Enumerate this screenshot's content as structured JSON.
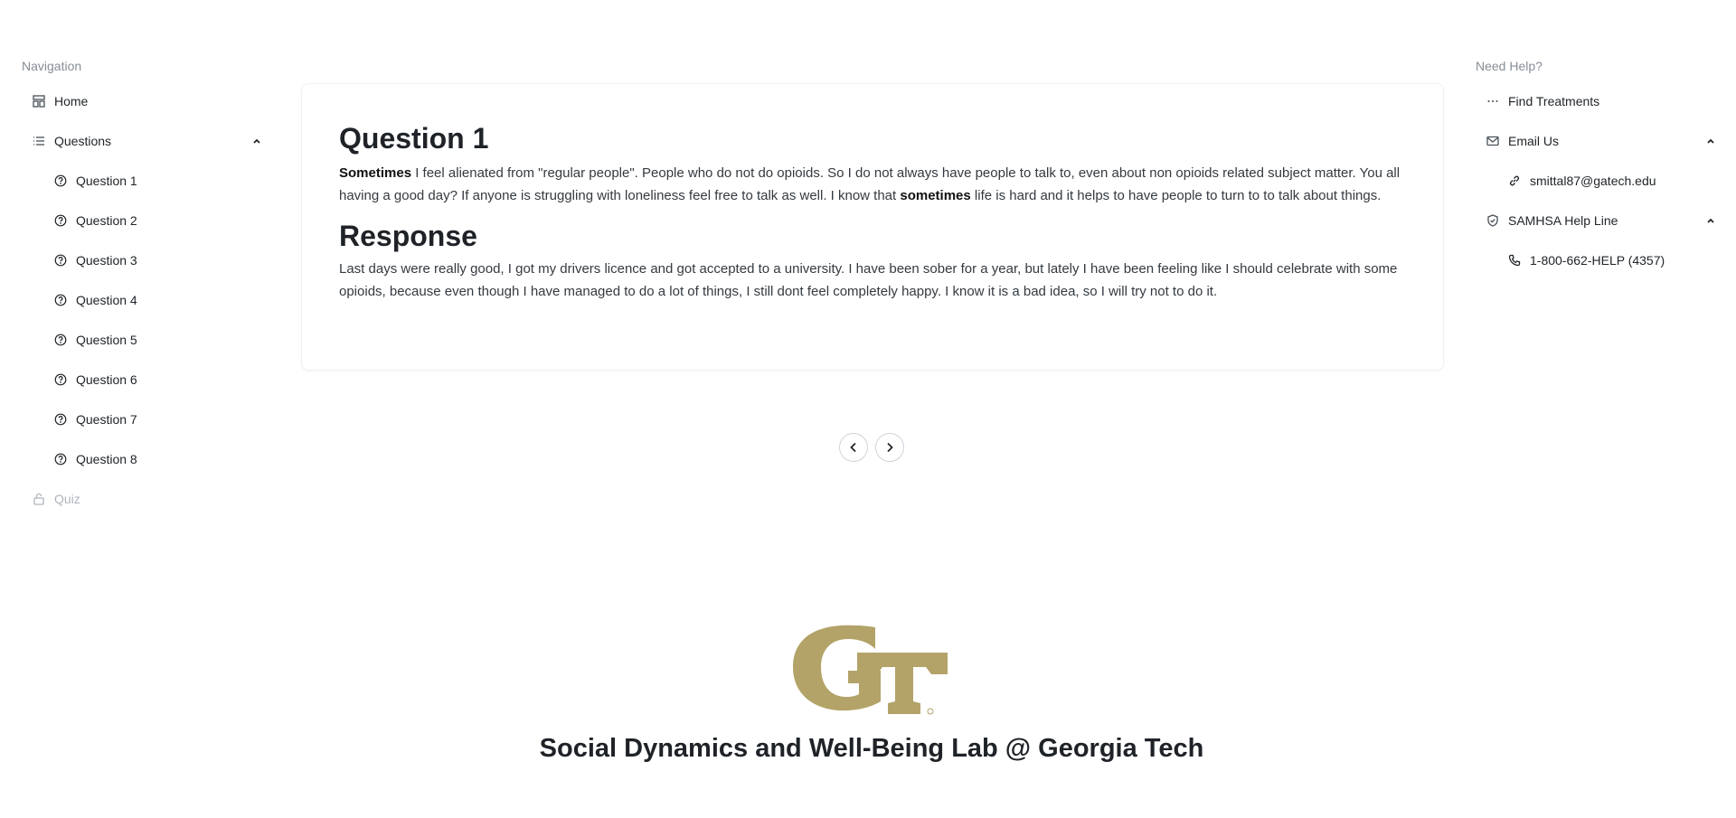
{
  "left_nav": {
    "heading": "Navigation",
    "home": {
      "label": "Home",
      "icon": "dashboard-icon"
    },
    "questions": {
      "label": "Questions",
      "icon": "list-icon",
      "expanded": true
    },
    "question_items": [
      "Question 1",
      "Question 2",
      "Question 3",
      "Question 4",
      "Question 5",
      "Question 6",
      "Question 7",
      "Question 8"
    ],
    "quiz": {
      "label": "Quiz",
      "icon": "lock-open-icon",
      "disabled": true
    }
  },
  "right_nav": {
    "heading": "Need Help?",
    "find_treatments": {
      "label": "Find Treatments",
      "icon": "dots-icon"
    },
    "email": {
      "label": "Email Us",
      "icon": "mail-icon",
      "expanded": true
    },
    "email_address": "smittal87@gatech.edu",
    "samhsa": {
      "label": "SAMHSA Help Line",
      "icon": "shield-check-icon",
      "expanded": true
    },
    "phone": "1-800-662-HELP (4357)"
  },
  "card": {
    "question_title": "Question 1",
    "question_bold_1": "Sometimes",
    "question_text_1": " I feel alienated from \"regular people\". People who do not do opioids. So I do not always have people to talk to, even about non opioids related subject matter. You all having a good day? If anyone is struggling with loneliness feel free to talk as well. I know that ",
    "question_bold_2": "sometimes",
    "question_text_2": " life is hard and it helps to have people to turn to to talk about things.",
    "response_title": "Response",
    "response_text": "Last days were really good, I got my drivers licence and got accepted to a university. I have been sober for a year, but lately I have been feeling like I should celebrate with some opioids, because even though I have managed to do a lot of things, I still dont feel completely happy. I know it is a bad idea, so I will try not to do it."
  },
  "pager": {
    "prev_icon": "chevron-left-icon",
    "next_icon": "chevron-right-icon"
  },
  "footer": {
    "logo_text": "GT",
    "logo_color": "#B3A369",
    "lab_title": "Social Dynamics and Well-Being Lab @ Georgia Tech"
  }
}
